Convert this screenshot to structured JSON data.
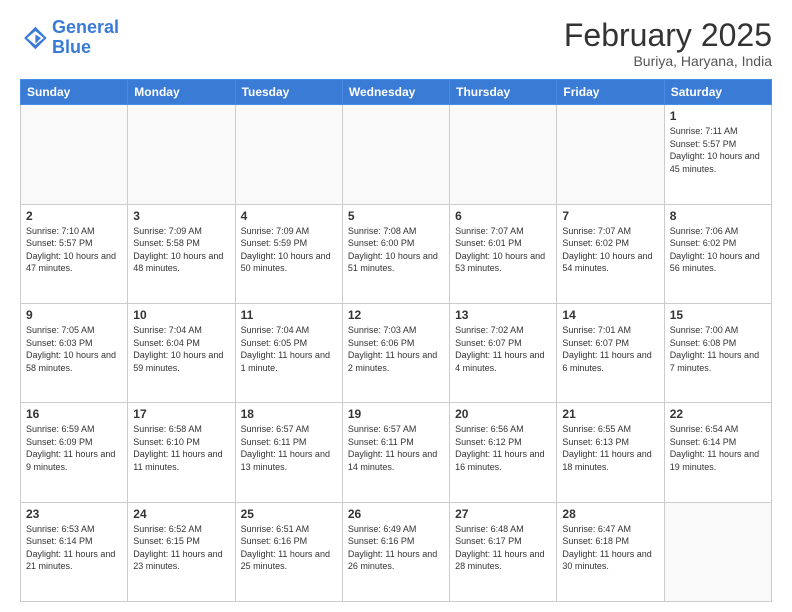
{
  "header": {
    "logo_line1": "General",
    "logo_line2": "Blue",
    "month_title": "February 2025",
    "location": "Buriya, Haryana, India"
  },
  "days_of_week": [
    "Sunday",
    "Monday",
    "Tuesday",
    "Wednesday",
    "Thursday",
    "Friday",
    "Saturday"
  ],
  "weeks": [
    [
      {
        "day": "",
        "info": ""
      },
      {
        "day": "",
        "info": ""
      },
      {
        "day": "",
        "info": ""
      },
      {
        "day": "",
        "info": ""
      },
      {
        "day": "",
        "info": ""
      },
      {
        "day": "",
        "info": ""
      },
      {
        "day": "1",
        "info": "Sunrise: 7:11 AM\nSunset: 5:57 PM\nDaylight: 10 hours and 45 minutes."
      }
    ],
    [
      {
        "day": "2",
        "info": "Sunrise: 7:10 AM\nSunset: 5:57 PM\nDaylight: 10 hours and 47 minutes."
      },
      {
        "day": "3",
        "info": "Sunrise: 7:09 AM\nSunset: 5:58 PM\nDaylight: 10 hours and 48 minutes."
      },
      {
        "day": "4",
        "info": "Sunrise: 7:09 AM\nSunset: 5:59 PM\nDaylight: 10 hours and 50 minutes."
      },
      {
        "day": "5",
        "info": "Sunrise: 7:08 AM\nSunset: 6:00 PM\nDaylight: 10 hours and 51 minutes."
      },
      {
        "day": "6",
        "info": "Sunrise: 7:07 AM\nSunset: 6:01 PM\nDaylight: 10 hours and 53 minutes."
      },
      {
        "day": "7",
        "info": "Sunrise: 7:07 AM\nSunset: 6:02 PM\nDaylight: 10 hours and 54 minutes."
      },
      {
        "day": "8",
        "info": "Sunrise: 7:06 AM\nSunset: 6:02 PM\nDaylight: 10 hours and 56 minutes."
      }
    ],
    [
      {
        "day": "9",
        "info": "Sunrise: 7:05 AM\nSunset: 6:03 PM\nDaylight: 10 hours and 58 minutes."
      },
      {
        "day": "10",
        "info": "Sunrise: 7:04 AM\nSunset: 6:04 PM\nDaylight: 10 hours and 59 minutes."
      },
      {
        "day": "11",
        "info": "Sunrise: 7:04 AM\nSunset: 6:05 PM\nDaylight: 11 hours and 1 minute."
      },
      {
        "day": "12",
        "info": "Sunrise: 7:03 AM\nSunset: 6:06 PM\nDaylight: 11 hours and 2 minutes."
      },
      {
        "day": "13",
        "info": "Sunrise: 7:02 AM\nSunset: 6:07 PM\nDaylight: 11 hours and 4 minutes."
      },
      {
        "day": "14",
        "info": "Sunrise: 7:01 AM\nSunset: 6:07 PM\nDaylight: 11 hours and 6 minutes."
      },
      {
        "day": "15",
        "info": "Sunrise: 7:00 AM\nSunset: 6:08 PM\nDaylight: 11 hours and 7 minutes."
      }
    ],
    [
      {
        "day": "16",
        "info": "Sunrise: 6:59 AM\nSunset: 6:09 PM\nDaylight: 11 hours and 9 minutes."
      },
      {
        "day": "17",
        "info": "Sunrise: 6:58 AM\nSunset: 6:10 PM\nDaylight: 11 hours and 11 minutes."
      },
      {
        "day": "18",
        "info": "Sunrise: 6:57 AM\nSunset: 6:11 PM\nDaylight: 11 hours and 13 minutes."
      },
      {
        "day": "19",
        "info": "Sunrise: 6:57 AM\nSunset: 6:11 PM\nDaylight: 11 hours and 14 minutes."
      },
      {
        "day": "20",
        "info": "Sunrise: 6:56 AM\nSunset: 6:12 PM\nDaylight: 11 hours and 16 minutes."
      },
      {
        "day": "21",
        "info": "Sunrise: 6:55 AM\nSunset: 6:13 PM\nDaylight: 11 hours and 18 minutes."
      },
      {
        "day": "22",
        "info": "Sunrise: 6:54 AM\nSunset: 6:14 PM\nDaylight: 11 hours and 19 minutes."
      }
    ],
    [
      {
        "day": "23",
        "info": "Sunrise: 6:53 AM\nSunset: 6:14 PM\nDaylight: 11 hours and 21 minutes."
      },
      {
        "day": "24",
        "info": "Sunrise: 6:52 AM\nSunset: 6:15 PM\nDaylight: 11 hours and 23 minutes."
      },
      {
        "day": "25",
        "info": "Sunrise: 6:51 AM\nSunset: 6:16 PM\nDaylight: 11 hours and 25 minutes."
      },
      {
        "day": "26",
        "info": "Sunrise: 6:49 AM\nSunset: 6:16 PM\nDaylight: 11 hours and 26 minutes."
      },
      {
        "day": "27",
        "info": "Sunrise: 6:48 AM\nSunset: 6:17 PM\nDaylight: 11 hours and 28 minutes."
      },
      {
        "day": "28",
        "info": "Sunrise: 6:47 AM\nSunset: 6:18 PM\nDaylight: 11 hours and 30 minutes."
      },
      {
        "day": "",
        "info": ""
      }
    ]
  ]
}
